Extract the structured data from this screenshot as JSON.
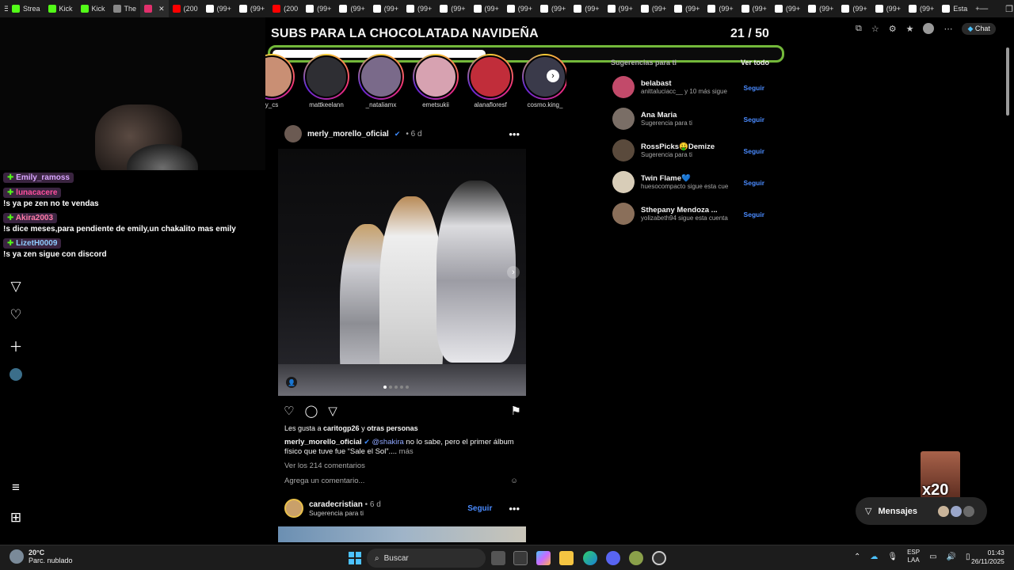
{
  "browser": {
    "tabs": [
      {
        "label": "Strea",
        "color": "#53fc18"
      },
      {
        "label": "Kick",
        "color": "#53fc18"
      },
      {
        "label": "Kick",
        "color": "#53fc18"
      },
      {
        "label": "The",
        "color": "#888888"
      },
      {
        "label": "",
        "color": "#e1306c",
        "active": true
      },
      {
        "label": "(200",
        "color": "#ff0000"
      },
      {
        "label": "(99+",
        "color": "#ffffff"
      },
      {
        "label": "(99+",
        "color": "#ffffff"
      },
      {
        "label": "(200",
        "color": "#ff0000"
      },
      {
        "label": "(99+",
        "color": "#ffffff"
      },
      {
        "label": "(99+",
        "color": "#ffffff"
      },
      {
        "label": "(99+",
        "color": "#ffffff"
      },
      {
        "label": "(99+",
        "color": "#ffffff"
      },
      {
        "label": "(99+",
        "color": "#ffffff"
      },
      {
        "label": "(99+",
        "color": "#ffffff"
      },
      {
        "label": "(99+",
        "color": "#ffffff"
      },
      {
        "label": "(99+",
        "color": "#ffffff"
      },
      {
        "label": "(99+",
        "color": "#ffffff"
      },
      {
        "label": "(99+",
        "color": "#ffffff"
      },
      {
        "label": "(99+",
        "color": "#ffffff"
      },
      {
        "label": "(99+",
        "color": "#ffffff"
      },
      {
        "label": "(99+",
        "color": "#ffffff"
      },
      {
        "label": "(99+",
        "color": "#ffffff"
      },
      {
        "label": "(99+",
        "color": "#ffffff"
      },
      {
        "label": "(99+",
        "color": "#ffffff"
      },
      {
        "label": "(99+",
        "color": "#ffffff"
      },
      {
        "label": "(99+",
        "color": "#ffffff"
      },
      {
        "label": "(99+",
        "color": "#ffffff"
      },
      {
        "label": "Esta",
        "color": "#ffffff"
      }
    ],
    "chat_button": "Chat"
  },
  "overlay": {
    "title": "SUBS PARA LA CHOCOLATADA NAVIDEÑA",
    "count_text": "21   / 50",
    "progress_fraction": 0.42,
    "accent": "#73b83a"
  },
  "stream_chat": [
    {
      "user": "Emily_ramoss",
      "user_color": "#d9a6ff",
      "text": ""
    },
    {
      "user": "lunacacere",
      "user_color": "#ff4f9e",
      "text": "!s ya pe zen no te vendas"
    },
    {
      "user": "Akira2003",
      "user_color": "#ff7aa8",
      "text": "!s dice meses,para pendiente de emily,un chakalito mas emily"
    },
    {
      "user": "LizetH0009",
      "user_color": "#8ecbff",
      "text": "!s ya zen sigue con discord"
    }
  ],
  "stories": [
    {
      "name": "y_cs",
      "color": "#c98f74"
    },
    {
      "name": "mattkeelann",
      "color": "#2e2e33"
    },
    {
      "name": "_nataliamx",
      "color": "#7a6a8a"
    },
    {
      "name": "emetsukii",
      "color": "#d7a2b1"
    },
    {
      "name": "alanafloresf",
      "color": "#c12d3a"
    },
    {
      "name": "cosmo.king_",
      "color": "#3a3a4a"
    }
  ],
  "post": {
    "user": "merly_morello_oficial",
    "time": "• 6 d",
    "likes_prefix": "Les gusta a ",
    "likes_user": "caritogp26",
    "likes_mid": " y ",
    "likes_others": "otras personas",
    "caption_user": "merly_morello_oficial",
    "caption_mention": "@shakira",
    "caption_text": " no lo sabe, pero el primer álbum físico que tuve fue “Sale el Sol”....",
    "caption_more": " más",
    "comments": "Ver los 214 comentarios",
    "add_comment": "Agrega un comentario..."
  },
  "post2": {
    "user": "caradecristian",
    "time": "• 6 d",
    "follow": "Seguir",
    "subtitle": "Sugerencia para ti"
  },
  "suggestions": {
    "header": "Sugerencias para ti",
    "see_all": "Ver todo",
    "items": [
      {
        "name": "belabast",
        "sub": "anittaluciacc__ y 10 más sigue",
        "follow": "Seguir",
        "color": "#c24a6a"
      },
      {
        "name": "Ana Maria",
        "sub": "Sugerencia para ti",
        "follow": "Seguir",
        "color": "#7a6e66"
      },
      {
        "name": "RossPicks🤑Demize",
        "sub": "Sugerencia para ti",
        "follow": "Seguir",
        "color": "#5a4a3c"
      },
      {
        "name": "Twin Flame💙",
        "sub": "huesocompacto sigue esta cue",
        "follow": "Seguir",
        "color": "#d8cdb8"
      },
      {
        "name": "Sthepany Mendoza ...",
        "sub": "yolizabeth94 sigue esta cuenta",
        "follow": "Seguir",
        "color": "#8a6f5a"
      }
    ]
  },
  "messages": {
    "label": "Mensajes"
  },
  "emote": {
    "label": "x20"
  },
  "taskbar": {
    "temp": "20°C",
    "weather": "Parc. nublado",
    "search": "Buscar",
    "lang_1": "ESP",
    "lang_2": "LAA",
    "time": "01:43",
    "date": "26/11/2025"
  }
}
